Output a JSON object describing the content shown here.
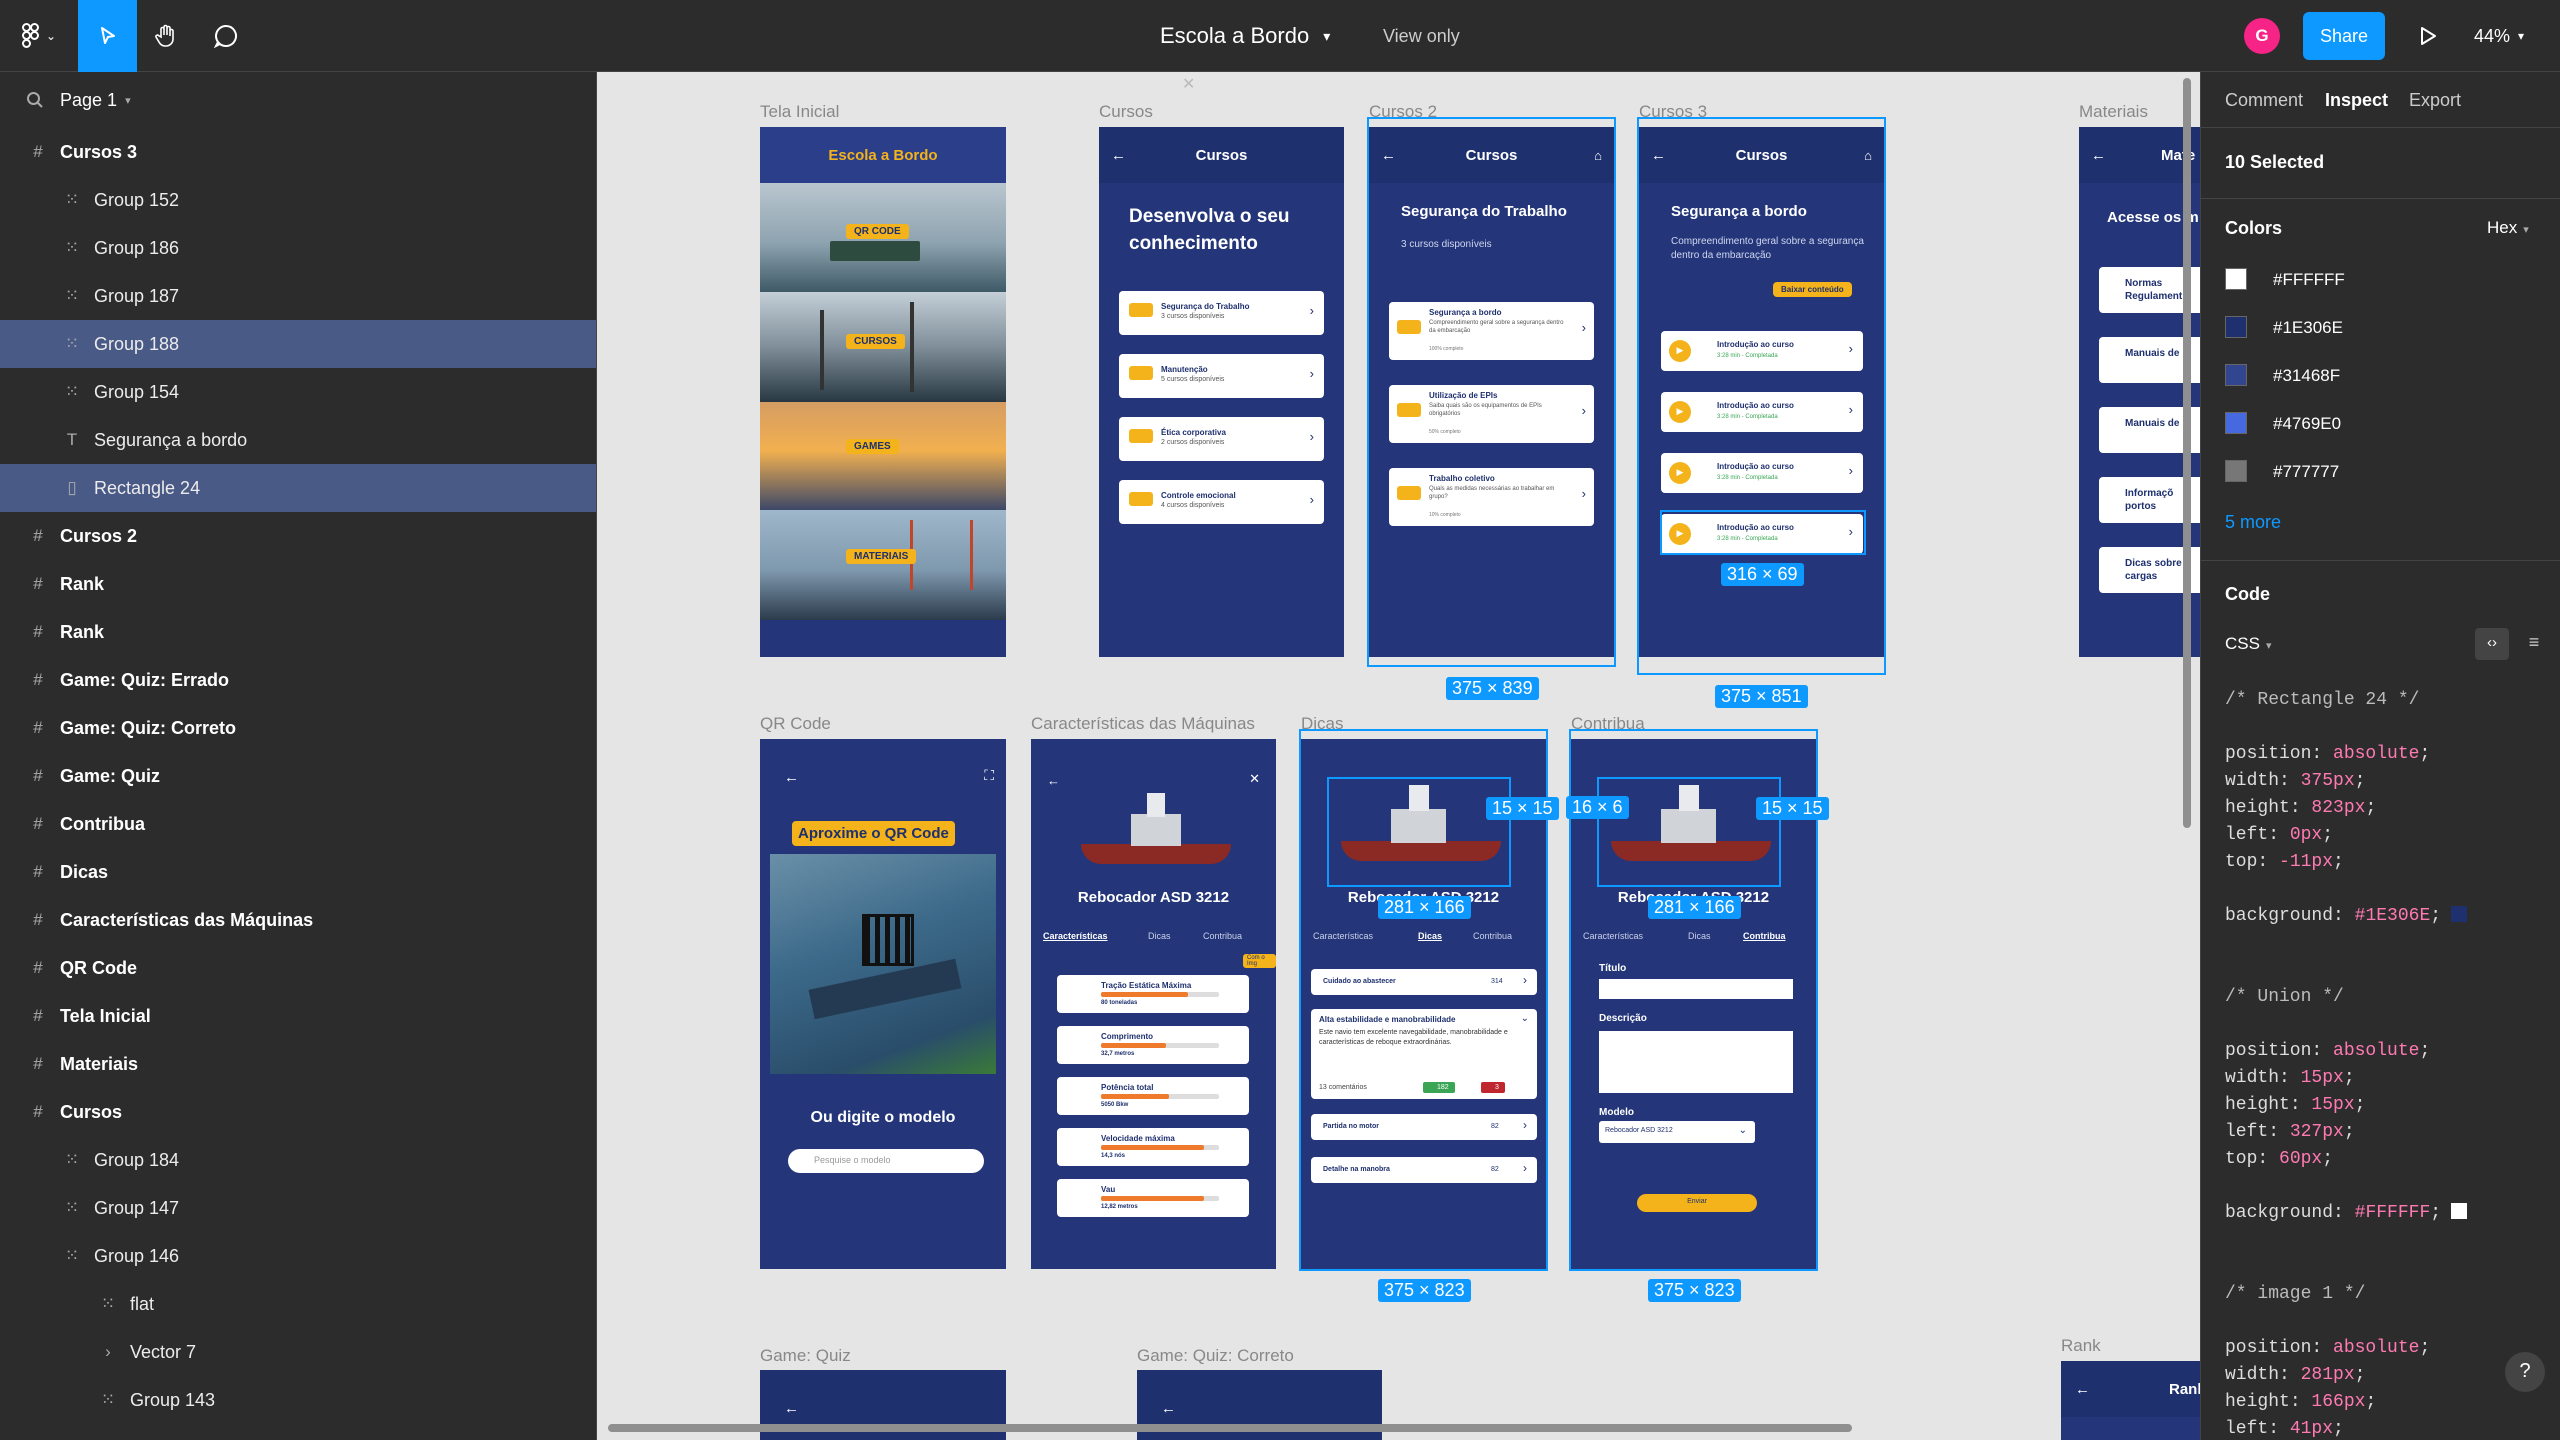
{
  "topbar": {
    "title": "Escola a Bordo",
    "mode": "View only",
    "avatar": "G",
    "share": "Share",
    "zoom": "44%"
  },
  "left": {
    "page": "Page 1",
    "layers": [
      {
        "label": "Cursos 3",
        "indent": 0,
        "icon": "frame",
        "bold": true,
        "sel": false
      },
      {
        "label": "Group 152",
        "indent": 1,
        "icon": "group",
        "bold": false,
        "sel": false
      },
      {
        "label": "Group 186",
        "indent": 1,
        "icon": "group",
        "bold": false,
        "sel": false
      },
      {
        "label": "Group 187",
        "indent": 1,
        "icon": "group",
        "bold": false,
        "sel": false
      },
      {
        "label": "Group 188",
        "indent": 1,
        "icon": "group",
        "bold": false,
        "sel": true
      },
      {
        "label": "Group 154",
        "indent": 1,
        "icon": "group",
        "bold": false,
        "sel": false
      },
      {
        "label": "Segurança a bordo",
        "indent": 1,
        "icon": "text",
        "bold": false,
        "sel": false
      },
      {
        "label": "Rectangle 24",
        "indent": 1,
        "icon": "rect",
        "bold": false,
        "sel": true
      },
      {
        "label": "Cursos 2",
        "indent": 0,
        "icon": "frame",
        "bold": true,
        "sel": false
      },
      {
        "label": "Rank",
        "indent": 0,
        "icon": "frame",
        "bold": true,
        "sel": false
      },
      {
        "label": "Rank",
        "indent": 0,
        "icon": "frame",
        "bold": true,
        "sel": false
      },
      {
        "label": "Game: Quiz: Errado",
        "indent": 0,
        "icon": "frame",
        "bold": true,
        "sel": false
      },
      {
        "label": "Game: Quiz: Correto",
        "indent": 0,
        "icon": "frame",
        "bold": true,
        "sel": false
      },
      {
        "label": "Game: Quiz",
        "indent": 0,
        "icon": "frame",
        "bold": true,
        "sel": false
      },
      {
        "label": "Contribua",
        "indent": 0,
        "icon": "frame",
        "bold": true,
        "sel": false
      },
      {
        "label": "Dicas",
        "indent": 0,
        "icon": "frame",
        "bold": true,
        "sel": false
      },
      {
        "label": "Características das Máquinas",
        "indent": 0,
        "icon": "frame",
        "bold": true,
        "sel": false
      },
      {
        "label": "QR Code",
        "indent": 0,
        "icon": "frame",
        "bold": true,
        "sel": false
      },
      {
        "label": "Tela Inicial",
        "indent": 0,
        "icon": "frame",
        "bold": true,
        "sel": false
      },
      {
        "label": "Materiais",
        "indent": 0,
        "icon": "frame",
        "bold": true,
        "sel": false
      },
      {
        "label": "Cursos",
        "indent": 0,
        "icon": "frame",
        "bold": true,
        "sel": false
      },
      {
        "label": "Group 184",
        "indent": 1,
        "icon": "group",
        "bold": false,
        "sel": false
      },
      {
        "label": "Group 147",
        "indent": 1,
        "icon": "group",
        "bold": false,
        "sel": false
      },
      {
        "label": "Group 146",
        "indent": 1,
        "icon": "group",
        "bold": false,
        "sel": false
      },
      {
        "label": "flat",
        "indent": 2,
        "icon": "group",
        "bold": false,
        "sel": false
      },
      {
        "label": "Vector 7",
        "indent": 2,
        "icon": "vector",
        "bold": false,
        "sel": false
      },
      {
        "label": "Group 143",
        "indent": 2,
        "icon": "group",
        "bold": false,
        "sel": false
      }
    ]
  },
  "canvas": {
    "labels": {
      "tela": "Tela Inicial",
      "cursos": "Cursos",
      "cursos2": "Cursos 2",
      "cursos3": "Cursos 3",
      "materiais": "Materiais",
      "qr": "QR Code",
      "carac": "Características das Máquinas",
      "dicas": "Dicas",
      "contribua": "Contribua",
      "quiz": "Game: Quiz",
      "quizc": "Game: Quiz: Correto",
      "rank": "Rank"
    },
    "tela": {
      "header": "Escola a Bordo",
      "tags": [
        "QR CODE",
        "CURSOS",
        "GAMES",
        "MATERIAIS"
      ]
    },
    "cursos": {
      "header": "Cursos",
      "title": "Desenvolva o seu conhecimento",
      "items": [
        [
          "Segurança do Trabalho",
          "3 cursos disponíveis"
        ],
        [
          "Manutenção",
          "5 cursos disponíveis"
        ],
        [
          "Ética corporativa",
          "2 cursos disponíveis"
        ],
        [
          "Controle emocional",
          "4 cursos disponíveis"
        ]
      ]
    },
    "cursos2": {
      "header": "Cursos",
      "title": "Segurança do Trabalho",
      "sub": "3 cursos disponíveis",
      "items": [
        [
          "Segurança a bordo",
          "Compreendimento geral sobre a segurança dentro da embarcação",
          "100% completo"
        ],
        [
          "Utilização de EPIs",
          "Saiba quais são os equipamentos de EPIs obrigatórios",
          "50% completo"
        ],
        [
          "Trabalho coletivo",
          "Quais as medidas necessárias ao trabalhar em grupo?",
          "10% completo"
        ]
      ]
    },
    "cursos3": {
      "header": "Cursos",
      "title": "Segurança a bordo",
      "sub": "Compreendimento geral sobre a segurança dentro da embarcação",
      "btn": "Baixar conteúdo",
      "items": [
        "Introdução ao curso",
        "Introdução ao curso",
        "Introdução ao curso",
        "Introdução ao curso"
      ],
      "meta": "3:28 min - Completada"
    },
    "materiais": {
      "head": "Mate",
      "title": "Acesse os m",
      "items": [
        "Normas Regulament",
        "Manuais de",
        "Manuais de",
        "Informaçõ portos",
        "Dicas sobre cargas"
      ]
    },
    "qr": {
      "title": "Aproxime o QR Code",
      "sub": "Ou digite o modelo",
      "placeholder": "Pesquise o modelo"
    },
    "carac": {
      "title": "Rebocador ASD 3212",
      "tabs": [
        "Características",
        "Dicas",
        "Contribua"
      ],
      "badge": "Com o Img",
      "items": [
        [
          "Tração Estática Máxima",
          "80 toneladas"
        ],
        [
          "Comprimento",
          "32,7 metros"
        ],
        [
          "Potência total",
          "5050 Bkw"
        ],
        [
          "Velocidade máxima",
          "14,3 nós"
        ],
        [
          "Vau",
          "12,82 metros"
        ]
      ]
    },
    "dicas": {
      "title": "Rebocador ASD 3212",
      "tabs": [
        "Características",
        "Dicas",
        "Contribua"
      ],
      "items": [
        [
          "Cuidado ao abastecer",
          "314"
        ],
        [
          "Partida no motor",
          "82"
        ],
        [
          "Detalhe na manobra",
          "82"
        ]
      ],
      "exp": {
        "t": "Alta estabilidade e manobrabilidade",
        "d": "Este navio tem excelente navegabilidade, manobrabilidade e características de reboque extraordinárias.",
        "c": "13 comentários",
        "up": "182",
        "down": "3"
      }
    },
    "contribua": {
      "title": "Rebocador ASD 3212",
      "tabs": [
        "Características",
        "Dicas",
        "Contribua"
      ],
      "f1": "Título",
      "f2": "Descrição",
      "f3": "Modelo",
      "model": "Rebocador ASD 3212",
      "send": "Enviar"
    },
    "dims": {
      "c2": "375 × 839",
      "c3": "375 × 851",
      "c3item": "316 × 69",
      "dicas": "375 × 823",
      "contr": "375 × 823",
      "img1": "281 × 166",
      "img2": "281 × 166",
      "x1": "15 × 15",
      "x2": "15 × 15",
      "arrow": "16 × 6"
    }
  },
  "right": {
    "tabs": [
      "Comment",
      "Inspect",
      "Export"
    ],
    "selected": "10 Selected",
    "colors_title": "Colors",
    "colors_fmt": "Hex",
    "colors": [
      {
        "hex": "#FFFFFF"
      },
      {
        "hex": "#1E306E"
      },
      {
        "hex": "#31468F"
      },
      {
        "hex": "#4769E0"
      },
      {
        "hex": "#777777"
      }
    ],
    "more": "5 more",
    "code_title": "Code",
    "lang": "CSS",
    "code": [
      {
        "c": "/* Rectangle 24 */"
      },
      {
        "c": ""
      },
      {
        "p": "position",
        "v": "absolute"
      },
      {
        "p": "width",
        "v": "375px"
      },
      {
        "p": "height",
        "v": "823px"
      },
      {
        "p": "left",
        "v": "0px"
      },
      {
        "p": "top",
        "v": "-11px"
      },
      {
        "c": ""
      },
      {
        "p": "background",
        "v": "#1E306E",
        "sw": "#1E306E"
      },
      {
        "c": ""
      },
      {
        "c": ""
      },
      {
        "c": "/* Union */"
      },
      {
        "c": ""
      },
      {
        "p": "position",
        "v": "absolute"
      },
      {
        "p": "width",
        "v": "15px"
      },
      {
        "p": "height",
        "v": "15px"
      },
      {
        "p": "left",
        "v": "327px"
      },
      {
        "p": "top",
        "v": "60px"
      },
      {
        "c": ""
      },
      {
        "p": "background",
        "v": "#FFFFFF",
        "sw": "#FFFFFF"
      },
      {
        "c": ""
      },
      {
        "c": ""
      },
      {
        "c": "/* image 1 */"
      },
      {
        "c": ""
      },
      {
        "p": "position",
        "v": "absolute"
      },
      {
        "p": "width",
        "v": "281px"
      },
      {
        "p": "height",
        "v": "166px"
      },
      {
        "p": "left",
        "v": "41px"
      }
    ]
  }
}
